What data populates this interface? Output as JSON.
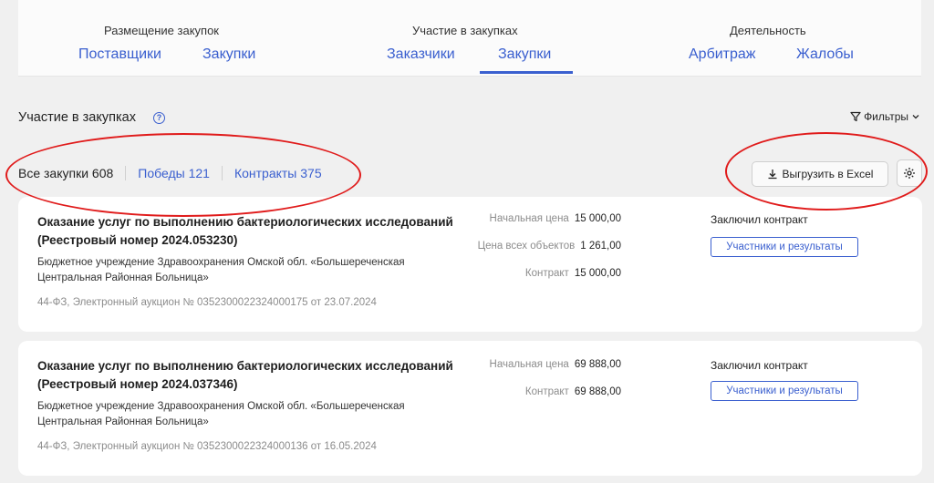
{
  "topnav": {
    "groups": [
      {
        "title": "Размещение закупок",
        "links": [
          "Поставщики",
          "Закупки"
        ]
      },
      {
        "title": "Участие в закупках",
        "links": [
          "Заказчики",
          "Закупки"
        ]
      },
      {
        "title": "Деятельность",
        "links": [
          "Арбитраж",
          "Жалобы"
        ]
      }
    ],
    "active_group": 1,
    "active_link": 1
  },
  "section": {
    "title": "Участие в закупках",
    "help_icon": "question-circle-icon",
    "filters_label": "Фильтры"
  },
  "tabs": [
    {
      "label": "Все закупки 608",
      "active": true
    },
    {
      "label": "Победы 121",
      "active": false
    },
    {
      "label": "Контракты 375",
      "active": false
    }
  ],
  "toolbar": {
    "export_label": "Выгрузить в Excel",
    "export_icon": "download-icon",
    "settings_icon": "gear-icon"
  },
  "cards": [
    {
      "title": "Оказание услуг по выполнению бактериологических исследований (Реестровый номер 2024.053230)",
      "org": "Бюджетное учреждение Здравоохранения Омской обл. «Большереченская Центральная Районная Больница»",
      "meta": "44-ФЗ, Электронный аукцион № 0352300022324000175 от 23.07.2024",
      "prices": [
        {
          "label": "Начальная цена",
          "value": "15 000,00"
        },
        {
          "label": "Цена всех объектов",
          "value": "1 261,00"
        },
        {
          "label": "Контракт",
          "value": "15 000,00"
        }
      ],
      "status": "Заключил контракт",
      "results_label": "Участники и результаты"
    },
    {
      "title": "Оказание услуг по выполнению бактериологических исследований (Реестровый номер 2024.037346)",
      "org": "Бюджетное учреждение Здравоохранения Омской обл. «Большереченская Центральная Районная Больница»",
      "meta": "44-ФЗ, Электронный аукцион № 0352300022324000136 от 16.05.2024",
      "prices": [
        {
          "label": "Начальная цена",
          "value": "69 888,00"
        },
        {
          "label": "Контракт",
          "value": "69 888,00"
        }
      ],
      "status": "Заключил контракт",
      "results_label": "Участники и результаты"
    }
  ],
  "colors": {
    "accent": "#3a5fcf",
    "annotation": "#e01b1b",
    "background": "#f0f0f0"
  }
}
